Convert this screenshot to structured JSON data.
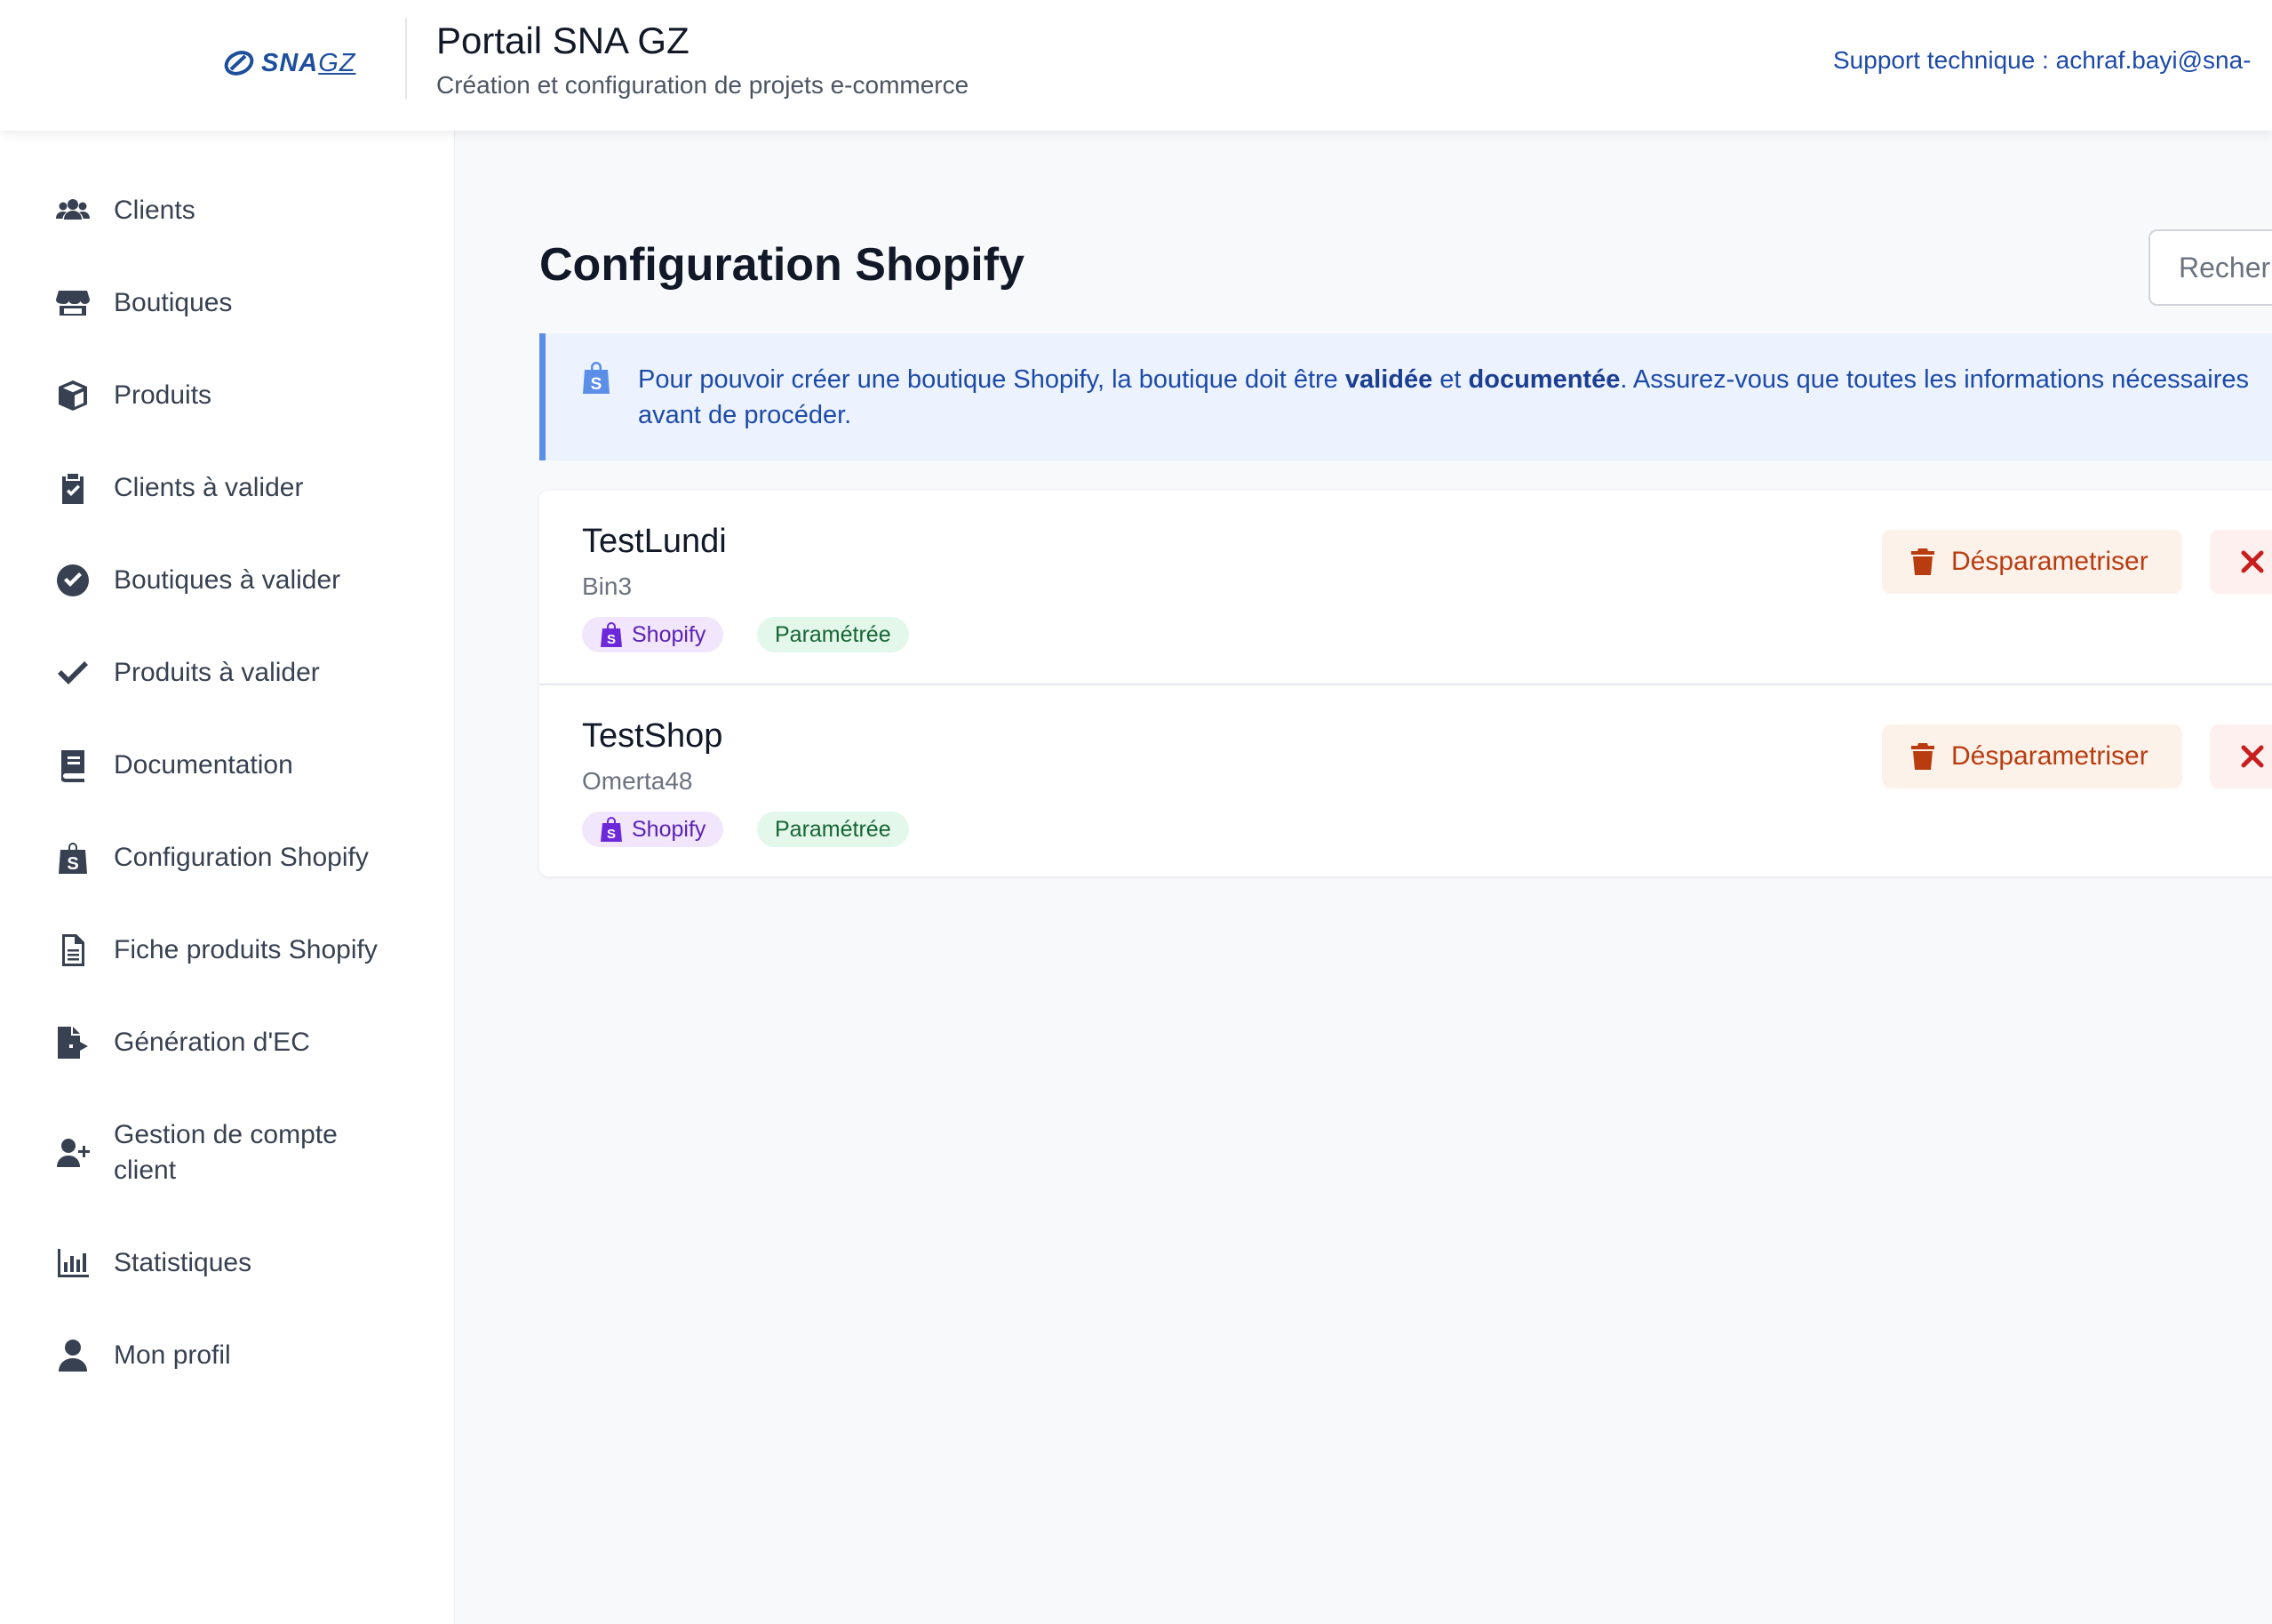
{
  "header": {
    "logo_text": "SNA",
    "logo_suffix": "GZ",
    "title": "Portail SNA GZ",
    "subtitle": "Création et configuration de projets e-commerce",
    "support": "Support technique : achraf.bayi@sna-"
  },
  "sidebar": {
    "items": [
      {
        "label": "Clients",
        "icon": "users-icon"
      },
      {
        "label": "Boutiques",
        "icon": "store-icon"
      },
      {
        "label": "Produits",
        "icon": "box-icon"
      },
      {
        "label": "Clients à valider",
        "icon": "clipboard-check-icon"
      },
      {
        "label": "Boutiques à valider",
        "icon": "circle-check-icon"
      },
      {
        "label": "Produits à valider",
        "icon": "check-icon"
      },
      {
        "label": "Documentation",
        "icon": "book-icon"
      },
      {
        "label": "Configuration Shopify",
        "icon": "shopify-bag-icon"
      },
      {
        "label": "Fiche produits Shopify",
        "icon": "file-lines-icon"
      },
      {
        "label": "Génération d'EC",
        "icon": "file-export-icon"
      },
      {
        "label": "Gestion de compte client",
        "icon": "user-plus-icon"
      },
      {
        "label": "Statistiques",
        "icon": "chart-bar-icon"
      },
      {
        "label": "Mon profil",
        "icon": "user-icon"
      }
    ]
  },
  "main": {
    "title": "Configuration Shopify",
    "search_placeholder": "Recher",
    "info": {
      "before": "Pour pouvoir créer une boutique Shopify, la boutique doit être ",
      "bold1": "validée",
      "middle": " et ",
      "bold2": "documentée",
      "after": ". Assurez-vous que toutes les informations nécessaires",
      "line2": "avant de procéder."
    },
    "shops": [
      {
        "name": "TestLundi",
        "owner": "Bin3",
        "platform_badge": "Shopify",
        "status_badge": "Paramétrée",
        "unparam_label": "Désparametriser"
      },
      {
        "name": "TestShop",
        "owner": "Omerta48",
        "platform_badge": "Shopify",
        "status_badge": "Paramétrée",
        "unparam_label": "Désparametriser"
      }
    ]
  },
  "colors": {
    "brand": "#1d4f9c",
    "link": "#1d4aa8",
    "danger": "#b93c11",
    "shopify_badge": "#f1e6fb",
    "status_badge": "#e3f7ea"
  }
}
